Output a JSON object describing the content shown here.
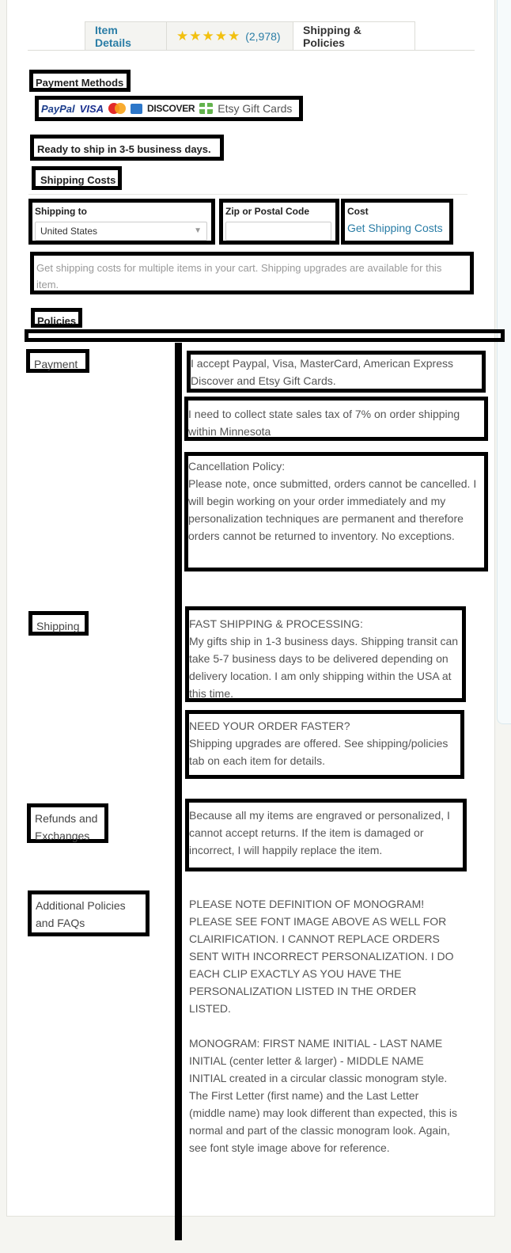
{
  "tabs": {
    "item_details": "Item Details",
    "review_count": "(2,978)",
    "shipping_policies": "Shipping & Policies"
  },
  "payment_methods": {
    "heading": "Payment Methods",
    "paypal": "PayPal",
    "visa": "VISA",
    "discover": "DISCOVER",
    "gift_cards": "Etsy Gift Cards"
  },
  "ready_to_ship": "Ready to ship in 3-5 business days.",
  "shipping_costs": {
    "heading": "Shipping Costs",
    "shipping_to_label": "Shipping to",
    "shipping_to_value": "United States",
    "zip_label": "Zip or Postal Code",
    "zip_value": "",
    "cost_label": "Cost",
    "get_costs_link": "Get Shipping Costs",
    "note": "Get shipping costs for multiple items in your cart. Shipping upgrades are available for this item."
  },
  "policies": {
    "heading": "Policies",
    "payment_label": "Payment",
    "payment_text_1": "I accept Paypal, Visa, MasterCard, American Express Discover and Etsy Gift Cards.",
    "payment_text_2": "I need to collect state sales tax of 7% on order shipping within Minnesota",
    "cancellation_title": "Cancellation Policy:",
    "cancellation_text": "Please note, once submitted, orders cannot be cancelled. I will begin working on your order immediately and my personalization techniques are permanent and therefore orders cannot be returned to inventory. No exceptions.",
    "shipping_label": "Shipping",
    "fast_title": "FAST SHIPPING & PROCESSING:",
    "fast_text": "My gifts ship in 1-3 business days. Shipping transit can take 5-7 business days to be delivered depending on delivery location. I am only shipping within the USA at this time.",
    "faster_title": "NEED YOUR ORDER FASTER?",
    "faster_text": "Shipping upgrades are offered. See shipping/policies tab on each item for details.",
    "refunds_label": "Refunds and Exchanges",
    "refunds_text": "Because all my items are engraved or personalized, I cannot accept returns. If the item is damaged or incorrect, I will happily replace the item.",
    "additional_label": "Additional Policies and FAQs",
    "additional_text_1": "PLEASE NOTE DEFINITION OF MONOGRAM! PLEASE SEE FONT IMAGE ABOVE AS WELL FOR CLAIRIFICATION. I CANNOT REPLACE ORDERS SENT WITH INCORRECT PERSONALIZATION. I DO EACH CLIP EXACTLY AS YOU HAVE THE PERSONALIZATION LISTED IN THE ORDER LISTED.",
    "additional_text_2": "MONOGRAM: FIRST NAME INITIAL - LAST NAME INITIAL (center letter & larger) - MIDDLE NAME INITIAL created in a circular classic monogram style. The First Letter (first name) and the Last Letter (middle name) may look different than expected, this is normal and part of the classic monogram look. Again, see font style image above for reference."
  }
}
